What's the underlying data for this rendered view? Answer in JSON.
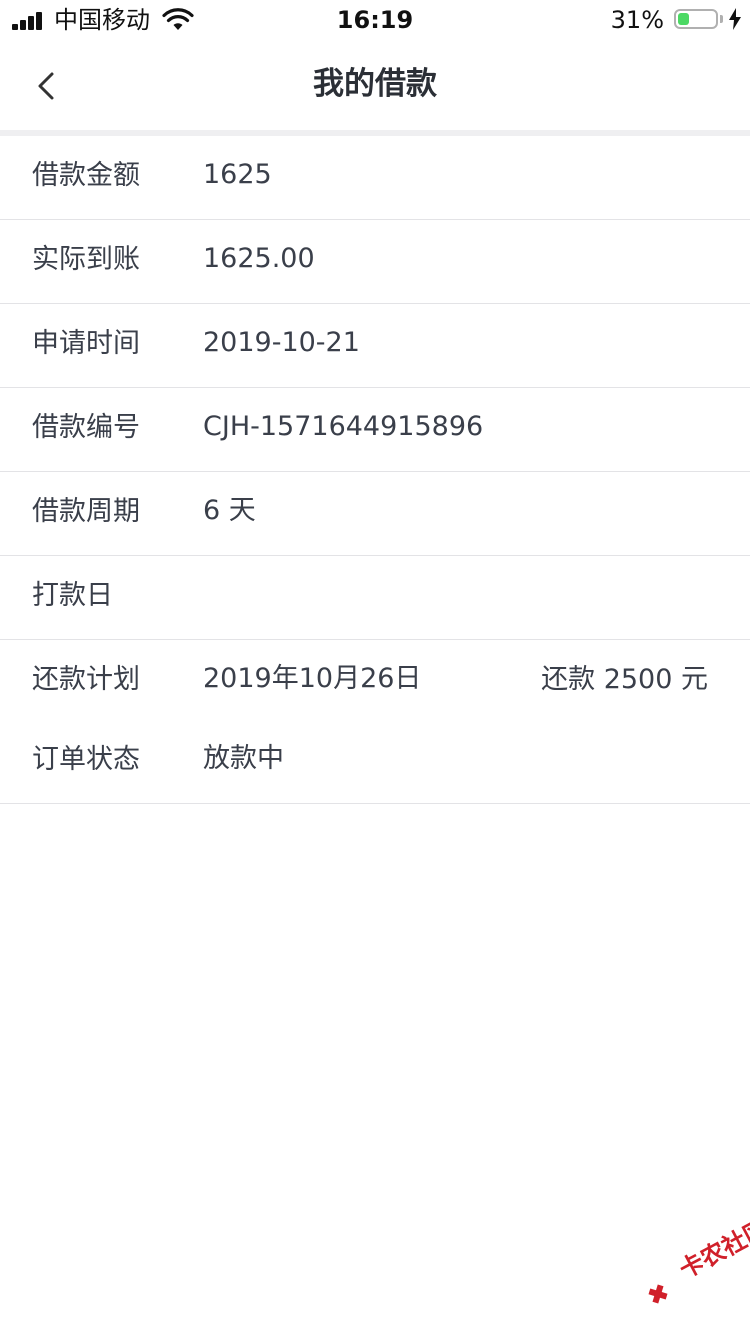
{
  "status_bar": {
    "carrier": "中国移动",
    "time": "16:19",
    "battery_percent_label": "31%",
    "battery_level": 0.31
  },
  "nav": {
    "title": "我的借款"
  },
  "rows": [
    {
      "label": "借款金额",
      "value": "1625"
    },
    {
      "label": "实际到账",
      "value": "1625.00"
    },
    {
      "label": "申请时间",
      "value": "2019-10-21"
    },
    {
      "label": "借款编号",
      "value": "CJH-1571644915896"
    },
    {
      "label": "借款周期",
      "value": "6 天"
    },
    {
      "label": "打款日",
      "value": ""
    },
    {
      "label": "还款计划",
      "value": "2019年10月26日",
      "extra": "还款 2500 元"
    },
    {
      "label": "订单状态",
      "value": "放款中"
    }
  ],
  "watermark": {
    "text": "卡农社区"
  },
  "colors": {
    "battery_fill": "#4cd964",
    "watermark": "#d0202a",
    "divider": "#e3e3e6"
  }
}
